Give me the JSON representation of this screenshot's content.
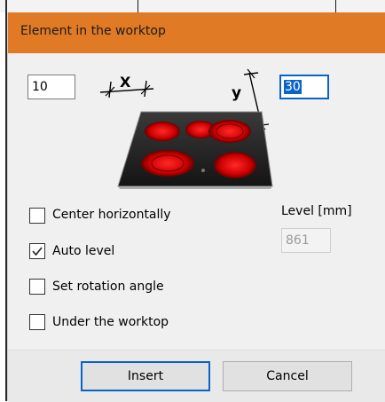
{
  "dialog": {
    "title": "Element in the worktop",
    "x_value": "10",
    "y_value": "30",
    "x_symbol": "X",
    "y_symbol": "y",
    "center_horizontally": {
      "label": "Center horizontally",
      "checked": false
    },
    "auto_level": {
      "label": "Auto level",
      "checked": true
    },
    "set_rotation_angle": {
      "label": "Set rotation angle",
      "checked": false
    },
    "under_the_worktop": {
      "label": "Under the worktop",
      "checked": false
    },
    "level_label": "Level [mm]",
    "level_value": "861",
    "insert_label": "Insert",
    "cancel_label": "Cancel"
  },
  "colors": {
    "title_bar": "#e07a25",
    "focus_blue": "#0a64c8"
  }
}
